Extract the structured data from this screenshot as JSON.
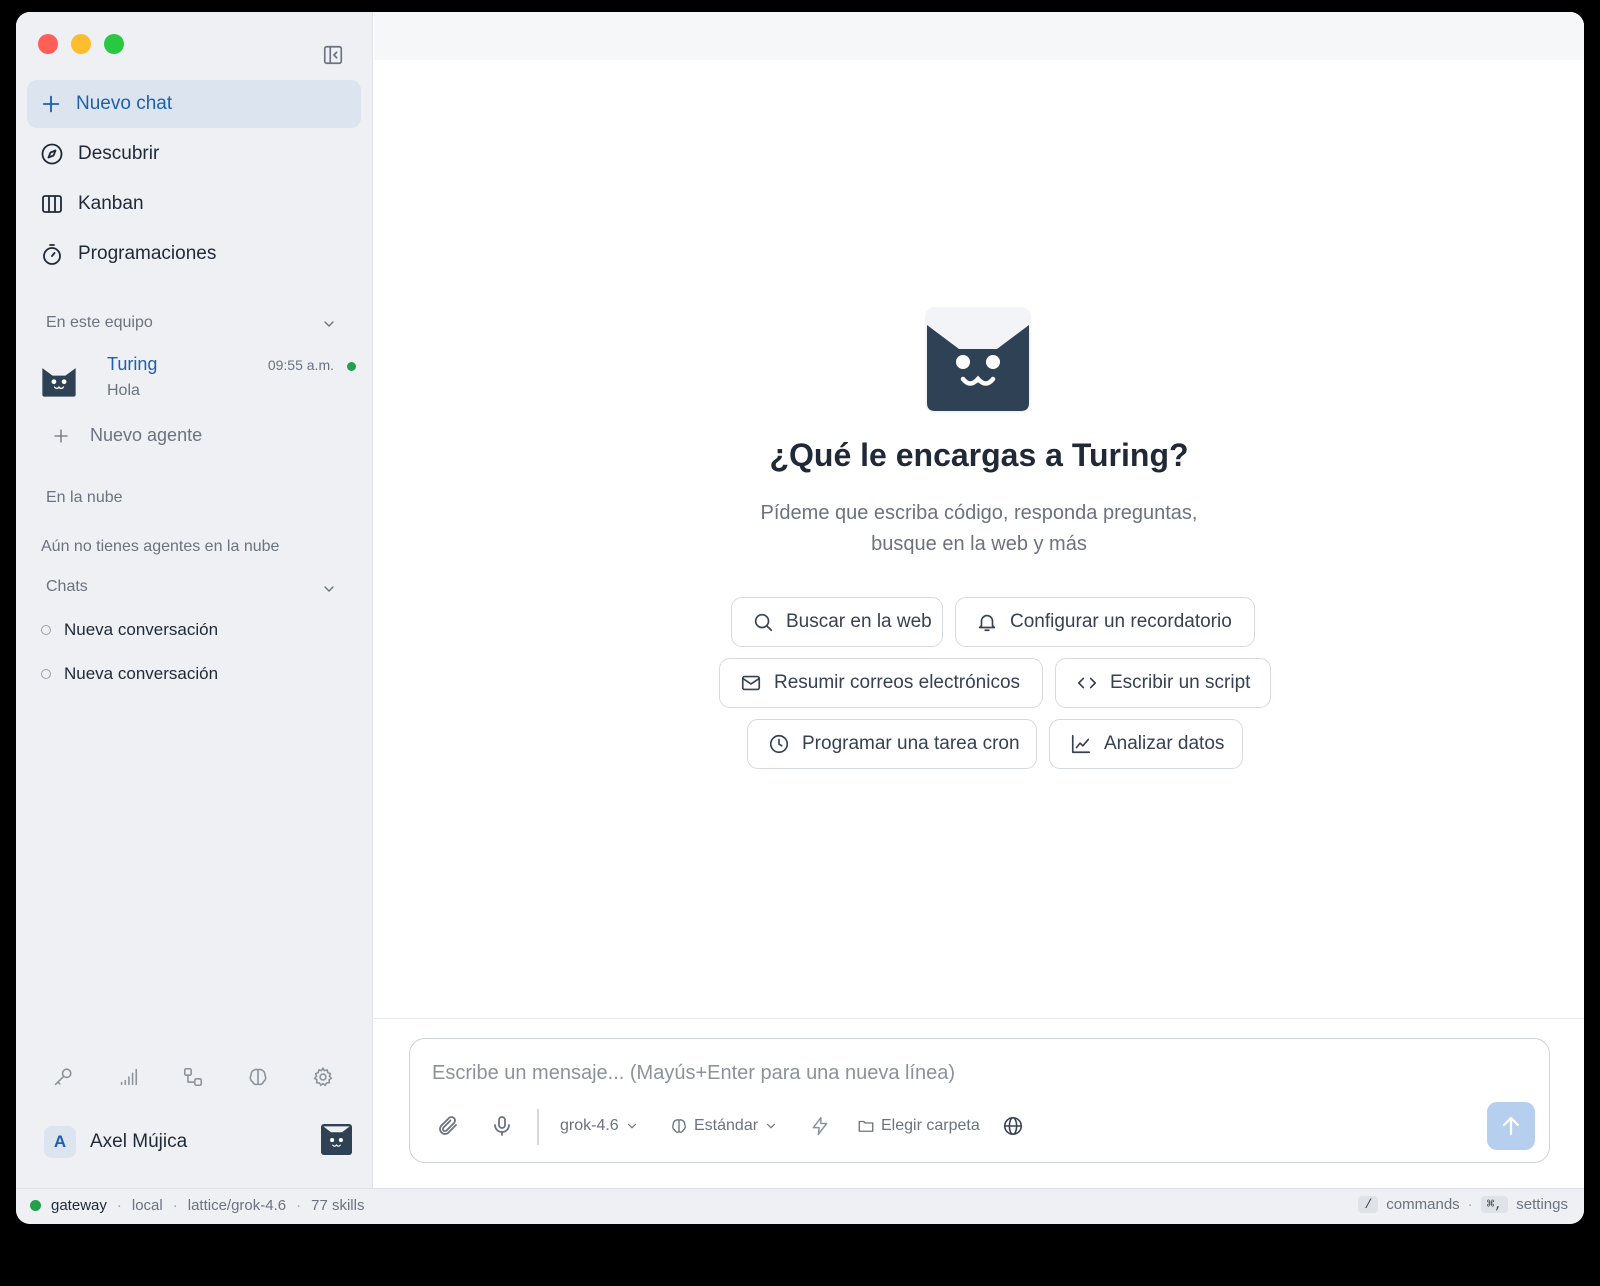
{
  "sidebar": {
    "nav": {
      "new_chat": "Nuevo chat",
      "discover": "Descubrir",
      "kanban": "Kanban",
      "schedules": "Programaciones"
    },
    "team_section": "En este equipo",
    "agent": {
      "name": "Turing",
      "preview": "Hola",
      "time": "09:55 a.m.",
      "status": "online"
    },
    "new_agent": "Nuevo agente",
    "cloud_section": "En la nube",
    "cloud_empty": "Aún no tienes agentes en la nube",
    "chats_section": "Chats",
    "chats": [
      {
        "label": "Nueva conversación"
      },
      {
        "label": "Nueva conversación"
      }
    ],
    "user": {
      "initial": "A",
      "name": "Axel Mújica"
    }
  },
  "main": {
    "title": "¿Qué le encargas a Turing?",
    "subtitle": "Pídeme que escriba código, responda preguntas, busque en la web y más",
    "suggestions": [
      {
        "label": "Buscar en la web",
        "icon": "search-icon"
      },
      {
        "label": "Configurar un recordatorio",
        "icon": "bell-icon"
      },
      {
        "label": "Resumir correos electrónicos",
        "icon": "mail-icon"
      },
      {
        "label": "Escribir un script",
        "icon": "code-icon"
      },
      {
        "label": "Programar una tarea cron",
        "icon": "clock-icon"
      },
      {
        "label": "Analizar datos",
        "icon": "line-chart-icon"
      }
    ]
  },
  "composer": {
    "placeholder": "Escribe un mensaje... (Mayús+Enter para una nueva línea)",
    "value": "",
    "model": "grok-4.6",
    "mode": "Estándar",
    "folder": "Elegir carpeta"
  },
  "statusbar": {
    "gateway": "gateway",
    "location": "local",
    "model_path": "lattice/grok-4.6",
    "skills": "77 skills",
    "commands_key": "/",
    "commands_label": "commands",
    "settings_key": "⌘,",
    "settings_label": "settings"
  },
  "colors": {
    "accent": "#1d5fb0",
    "sidebar_bg": "#eef0f3",
    "active_bg": "#dce4ef",
    "logo_dark": "#2f4154",
    "online": "#22a04b",
    "send_disabled": "#b7cfee"
  }
}
